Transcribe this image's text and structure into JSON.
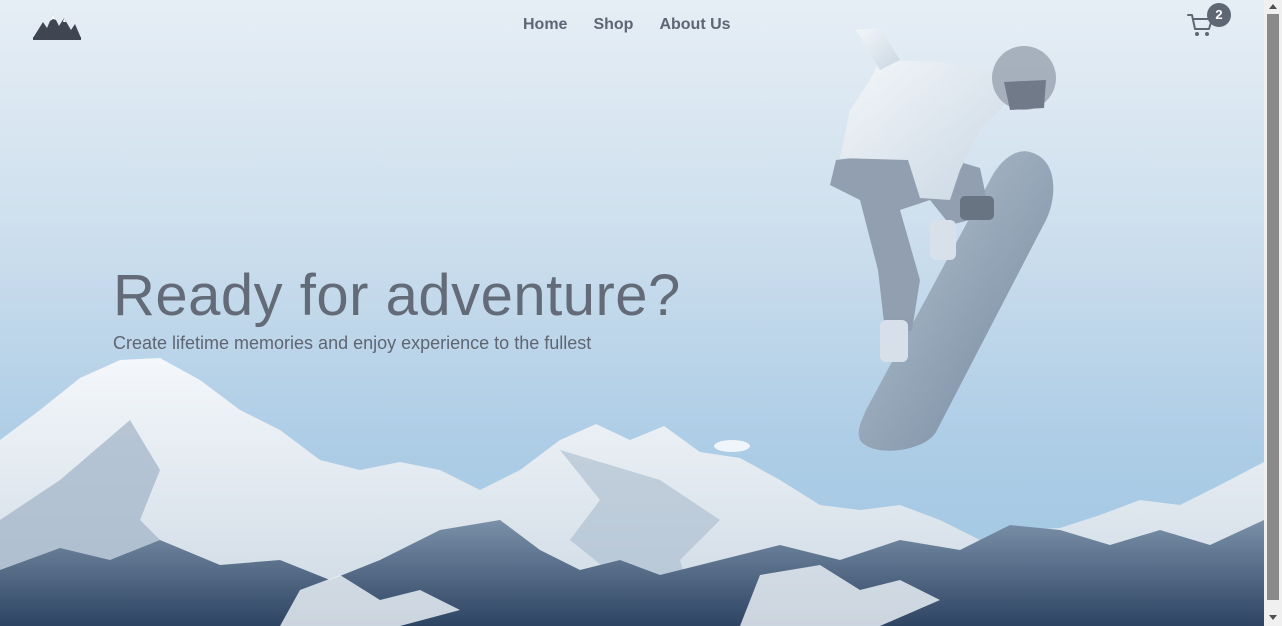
{
  "navbar": {
    "logo_icon": "mountain-logo-icon",
    "links": [
      {
        "label": "Home"
      },
      {
        "label": "Shop"
      },
      {
        "label": "About Us"
      }
    ],
    "cart": {
      "icon": "cart-icon",
      "count": "2"
    }
  },
  "hero": {
    "title": "Ready for adventure?",
    "subtitle": "Create lifetime memories and enjoy experience to the fullest"
  },
  "colors": {
    "text": "#646b78",
    "badge": "#5f6774",
    "sky_top": "#e6eef5",
    "sky_bottom": "#9fc6e2"
  }
}
